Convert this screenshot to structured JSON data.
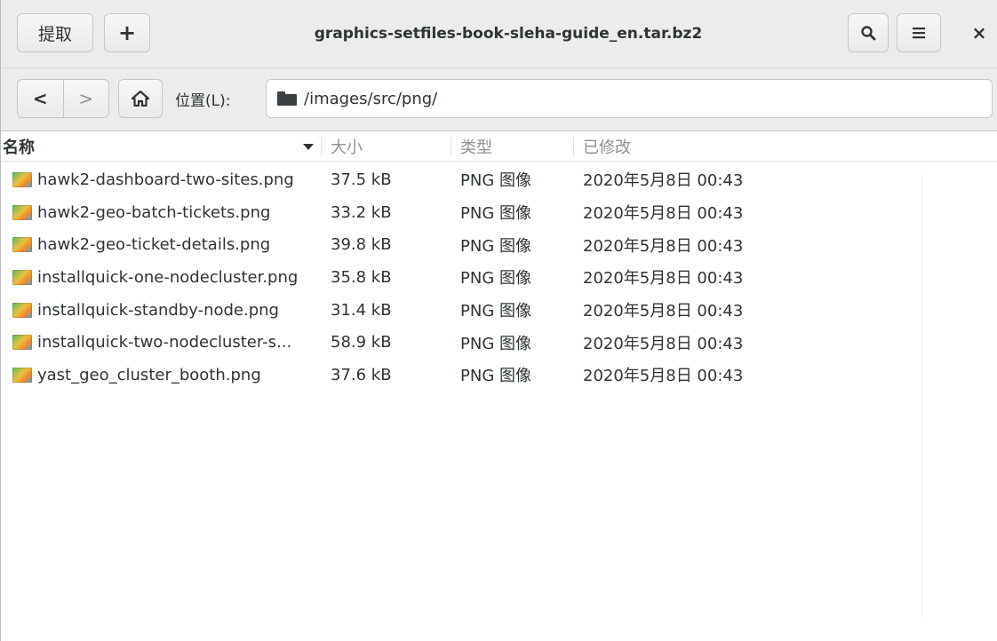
{
  "window": {
    "title": "graphics-setfiles-book-sleha-guide_en.tar.bz2"
  },
  "header": {
    "extract_label": "提取",
    "add_label": "+",
    "search_icon": "search-icon",
    "menu_icon": "hamburger-menu-icon",
    "close_label": "×"
  },
  "location": {
    "back_label": "<",
    "forward_label": ">",
    "home_icon": "home-icon",
    "label": "位置(L):",
    "path": "/images/src/png/"
  },
  "columns": {
    "name": "名称",
    "size": "大小",
    "type": "类型",
    "modified": "已修改"
  },
  "files": [
    {
      "name": "hawk2-dashboard-two-sites.png",
      "size": "37.5 kB",
      "type": "PNG 图像",
      "modified": "2020年5月8日 00:43"
    },
    {
      "name": "hawk2-geo-batch-tickets.png",
      "size": "33.2 kB",
      "type": "PNG 图像",
      "modified": "2020年5月8日 00:43"
    },
    {
      "name": "hawk2-geo-ticket-details.png",
      "size": "39.8 kB",
      "type": "PNG 图像",
      "modified": "2020年5月8日 00:43"
    },
    {
      "name": "installquick-one-nodecluster.png",
      "size": "35.8 kB",
      "type": "PNG 图像",
      "modified": "2020年5月8日 00:43"
    },
    {
      "name": "installquick-standby-node.png",
      "size": "31.4 kB",
      "type": "PNG 图像",
      "modified": "2020年5月8日 00:43"
    },
    {
      "name": "installquick-two-nodecluster-s...",
      "size": "58.9 kB",
      "type": "PNG 图像",
      "modified": "2020年5月8日 00:43"
    },
    {
      "name": "yast_geo_cluster_booth.png",
      "size": "37.6 kB",
      "type": "PNG 图像",
      "modified": "2020年5月8日 00:43"
    }
  ]
}
